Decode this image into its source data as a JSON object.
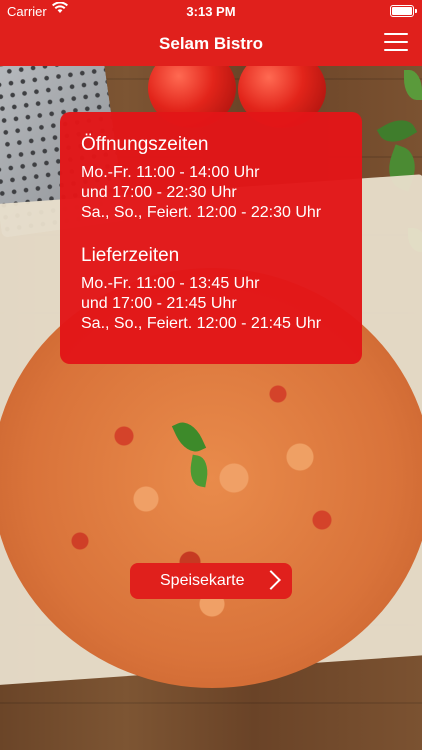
{
  "status_bar": {
    "carrier": "Carrier",
    "wifi_icon": "wifi-icon",
    "time": "3:13 PM",
    "battery_icon": "battery-icon"
  },
  "nav": {
    "title": "Selam Bistro",
    "menu_icon": "hamburger-menu-icon"
  },
  "opening_hours": {
    "title": "Öffnungszeiten",
    "lines": [
      "Mo.-Fr. 11:00 - 14:00 Uhr",
      "und 17:00 - 22:30 Uhr",
      "Sa., So., Feiert. 12:00 - 22:30 Uhr"
    ]
  },
  "delivery_hours": {
    "title": "Lieferzeiten",
    "lines": [
      "Mo.-Fr. 11:00 - 13:45 Uhr",
      "und 17:00 - 21:45 Uhr",
      "Sa., So., Feiert. 12:00 - 21:45 Uhr"
    ]
  },
  "menu_button": {
    "label": "Speisekarte",
    "icon": "chevron-right-icon"
  },
  "colors": {
    "accent": "#e0201c"
  }
}
